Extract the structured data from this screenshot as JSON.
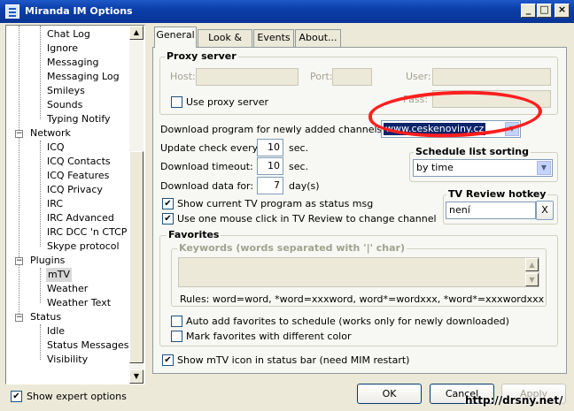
{
  "window": {
    "title": "Miranda IM Options"
  },
  "titlebar_buttons": {
    "minimize": "_",
    "maximize": "□",
    "close": "×"
  },
  "tree": {
    "items": [
      "Chat Log",
      "Ignore",
      "Messaging",
      "Messaging Log",
      "Smileys",
      "Sounds",
      "Typing Notify",
      "Network",
      "ICQ",
      "ICQ Contacts",
      "ICQ Features",
      "ICQ Privacy",
      "IRC",
      "IRC Advanced",
      "IRC DCC 'n CTCP",
      "Skype protocol",
      "Plugins",
      "mTV",
      "Weather",
      "Weather Text",
      "Status",
      "Idle",
      "Status Messages",
      "Visibility"
    ],
    "selected": "mTV"
  },
  "tabs": [
    "General",
    "Look & feel",
    "Events",
    "About..."
  ],
  "active_tab": "General",
  "proxy": {
    "legend": "Proxy server",
    "host_label": "Host:",
    "port_label": "Port:",
    "user_label": "User:",
    "pass_label": "Pass:",
    "use_proxy_label": "Use proxy server"
  },
  "download": {
    "source_label": "Download program for newly added channels from:",
    "source_value": "www.ceskenoviny.cz",
    "update_label": "Update check every:",
    "update_value": "10",
    "update_unit": "sec.",
    "timeout_label": "Download timeout:",
    "timeout_value": "10",
    "timeout_unit": "sec.",
    "data_label": "Download data for:",
    "data_value": "7",
    "data_unit": "day(s)"
  },
  "schedule": {
    "legend": "Schedule list sorting",
    "value": "by time"
  },
  "hotkey": {
    "legend": "TV Review hotkey",
    "value": "není",
    "clear_label": "X"
  },
  "options": {
    "status_msg_label": "Show current TV program as status msg",
    "one_click_label": "Use one mouse click in TV Review to change channel"
  },
  "favorites": {
    "legend": "Favorites",
    "keywords_legend": "Keywords (words separated with '|' char)",
    "rules": "Rules: word=word, *word=xxxword, word*=wordxxx, *word*=xxxwordxxx",
    "auto_add_label": "Auto add favorites to schedule (works only for newly downloaded)",
    "mark_label": "Mark favorites with different color"
  },
  "status_bar_label": "Show mTV icon in status bar (need MIM restart)",
  "expert_label": "Show expert options",
  "buttons": {
    "ok": "OK",
    "cancel": "Cancel",
    "apply": "Apply"
  },
  "watermark": "http://drsny.net/",
  "colors": {
    "title_bar": "#0a3ea8",
    "annotation": "#ff1e1e",
    "selection": "#0a246a"
  }
}
